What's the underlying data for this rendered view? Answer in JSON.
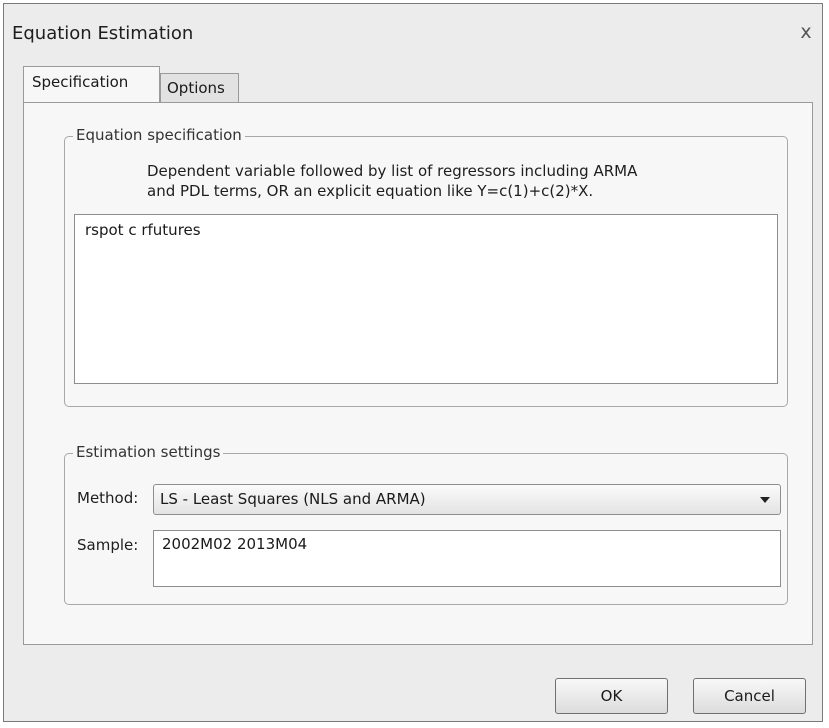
{
  "window": {
    "title": "Equation Estimation",
    "close_glyph": "x"
  },
  "tabs": [
    {
      "label": "Specification",
      "active": true
    },
    {
      "label": "Options",
      "active": false
    }
  ],
  "equation_group": {
    "legend": "Equation specification",
    "instructions_line1": "Dependent variable followed by list of regressors including ARMA",
    "instructions_line2": "and PDL terms, OR an explicit equation like Y=c(1)+c(2)*X.",
    "equation_value": "rspot c rfutures"
  },
  "estimation_group": {
    "legend": "Estimation settings",
    "method_label": "Method:",
    "method_value": "LS  - Least Squares (NLS and ARMA)",
    "sample_label": "Sample:",
    "sample_value": "2002M02 2013M04"
  },
  "buttons": {
    "ok": "OK",
    "cancel": "Cancel"
  },
  "icons": {
    "close": "close-icon",
    "dropdown": "chevron-down-icon"
  }
}
